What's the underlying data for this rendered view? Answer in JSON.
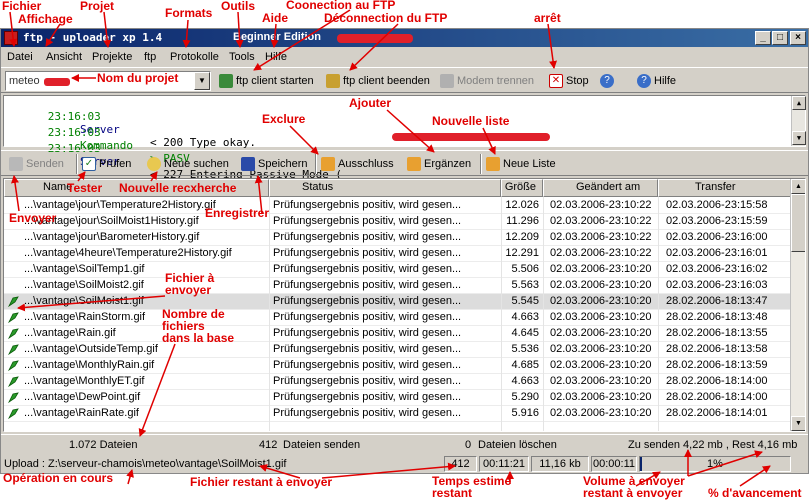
{
  "window": {
    "title": "ftp - uploader  xp 1.4",
    "edition": "Beginner Edition",
    "controls": [
      "_",
      "□",
      "×"
    ]
  },
  "menu": [
    "Datei",
    "Ansicht",
    "Projekte",
    "ftp",
    "Protokolle",
    "Tools",
    "Hilfe"
  ],
  "toolbar1": {
    "project_value": "meteo",
    "buttons": [
      {
        "label": "ftp client starten",
        "icon": "connect-icon"
      },
      {
        "label": "ftp client beenden",
        "icon": "disconnect-icon"
      },
      {
        "label": "Modem trennen",
        "icon": "modem-icon"
      },
      {
        "label": "Stop",
        "icon": "stop-icon"
      },
      {
        "label": "",
        "icon": "help-question-icon"
      },
      {
        "label": "Hilfe",
        "icon": "help-icon"
      }
    ]
  },
  "log": [
    {
      "time": "23:16:03",
      "source": "Server",
      "message": "< 200 Type okay."
    },
    {
      "time": "23:16:03",
      "source": "Kommando",
      "message": "> PASV"
    },
    {
      "time": "23:16:03",
      "source": "Server",
      "message": "< 227 Entering Passive Mode ("
    }
  ],
  "toolbar2": {
    "buttons": [
      {
        "label": "Senden",
        "icon": "send-icon",
        "enabled": false
      },
      {
        "label": "Prüfen",
        "icon": "check-icon",
        "enabled": true
      },
      {
        "label": "Neue suchen",
        "icon": "search-icon",
        "enabled": true
      },
      {
        "label": "Speichern",
        "icon": "save-icon",
        "enabled": true
      },
      {
        "label": "Ausschluss",
        "icon": "exclude-icon",
        "enabled": true
      },
      {
        "label": "Ergänzen",
        "icon": "add-icon",
        "enabled": true
      },
      {
        "label": "Neue Liste",
        "icon": "new-list-icon",
        "enabled": true
      }
    ]
  },
  "table": {
    "columns": [
      "Name",
      "Status",
      "Größe",
      "Geändert am",
      "Transfer"
    ],
    "rows": [
      {
        "name": "...\\vantage\\jour\\Temperature2History.gif",
        "status": "Prüfungsergebnis positiv, wird gesen...",
        "size": "12.026",
        "changed": "02.03.2006-23:10:22",
        "transfer": "02.03.2006-23:15:58",
        "icon": false,
        "selected": false
      },
      {
        "name": "...\\vantage\\jour\\SoilMoist1History.gif",
        "status": "Prüfungsergebnis positiv, wird gesen...",
        "size": "11.296",
        "changed": "02.03.2006-23:10:22",
        "transfer": "02.03.2006-23:15:59",
        "icon": false,
        "selected": false
      },
      {
        "name": "...\\vantage\\jour\\BarometerHistory.gif",
        "status": "Prüfungsergebnis positiv, wird gesen...",
        "size": "12.209",
        "changed": "02.03.2006-23:10:22",
        "transfer": "02.03.2006-23:16:00",
        "icon": false,
        "selected": false
      },
      {
        "name": "...\\vantage\\4heure\\Temperature2History.gif",
        "status": "Prüfungsergebnis positiv, wird gesen...",
        "size": "12.291",
        "changed": "02.03.2006-23:10:22",
        "transfer": "02.03.2006-23:16:01",
        "icon": false,
        "selected": false
      },
      {
        "name": "...\\vantage\\SoilTemp1.gif",
        "status": "Prüfungsergebnis positiv, wird gesen...",
        "size": "5.506",
        "changed": "02.03.2006-23:10:20",
        "transfer": "02.03.2006-23:16:02",
        "icon": false,
        "selected": false
      },
      {
        "name": "...\\vantage\\SoilMoist2.gif",
        "status": "Prüfungsergebnis positiv, wird gesen...",
        "size": "5.563",
        "changed": "02.03.2006-23:10:20",
        "transfer": "02.03.2006-23:16:03",
        "icon": false,
        "selected": false
      },
      {
        "name": "...\\vantage\\SoilMoist1.gif",
        "status": "Prüfungsergebnis positiv, wird gesen...",
        "size": "5.545",
        "changed": "02.03.2006-23:10:20",
        "transfer": "28.02.2006-18:13:47",
        "icon": true,
        "selected": true
      },
      {
        "name": "...\\vantage\\RainStorm.gif",
        "status": "Prüfungsergebnis positiv, wird gesen...",
        "size": "4.663",
        "changed": "02.03.2006-23:10:20",
        "transfer": "28.02.2006-18:13:48",
        "icon": true,
        "selected": false
      },
      {
        "name": "...\\vantage\\Rain.gif",
        "status": "Prüfungsergebnis positiv, wird gesen...",
        "size": "4.645",
        "changed": "02.03.2006-23:10:20",
        "transfer": "28.02.2006-18:13:55",
        "icon": true,
        "selected": false
      },
      {
        "name": "...\\vantage\\OutsideTemp.gif",
        "status": "Prüfungsergebnis positiv, wird gesen...",
        "size": "5.536",
        "changed": "02.03.2006-23:10:20",
        "transfer": "28.02.2006-18:13:58",
        "icon": true,
        "selected": false
      },
      {
        "name": "...\\vantage\\MonthlyRain.gif",
        "status": "Prüfungsergebnis positiv, wird gesen...",
        "size": "4.685",
        "changed": "02.03.2006-23:10:20",
        "transfer": "28.02.2006-18:13:59",
        "icon": true,
        "selected": false
      },
      {
        "name": "...\\vantage\\MonthlyET.gif",
        "status": "Prüfungsergebnis positiv, wird gesen...",
        "size": "4.663",
        "changed": "02.03.2006-23:10:20",
        "transfer": "28.02.2006-18:14:00",
        "icon": true,
        "selected": false
      },
      {
        "name": "...\\vantage\\DewPoint.gif",
        "status": "Prüfungsergebnis positiv, wird gesen...",
        "size": "5.290",
        "changed": "02.03.2006-23:10:20",
        "transfer": "28.02.2006-18:14:00",
        "icon": true,
        "selected": false
      },
      {
        "name": "...\\vantage\\RainRate.gif",
        "status": "Prüfungsergebnis positiv, wird gesen...",
        "size": "5.916",
        "changed": "02.03.2006-23:10:20",
        "transfer": "28.02.2006-18:14:01",
        "icon": true,
        "selected": false
      }
    ]
  },
  "status": {
    "files": "1.072 Dateien",
    "send_count": "412",
    "send_label": "Dateien senden",
    "delete_count": "0",
    "delete_label": "Dateien löschen",
    "volume": "Zu senden 4,22 mb , Rest 4,16 mb",
    "upload_path": "Upload : Z:\\serveur-chamois\\meteo\\vantage\\SoilMoist1.gif",
    "remaining_files": "412",
    "estimated_time": "00:11:21",
    "speed": "11,16  kb",
    "elapsed": "00:00:11",
    "progress_text": "1%",
    "progress": 0.01
  },
  "annotations": {
    "fichier": "Fichier",
    "affichage": "Affichage",
    "projet": "Projet",
    "formats": "Formats",
    "outils": "Outils",
    "aide": "Aide",
    "connexion": "Coonection au FTP",
    "deconnexion": "Déconnection du FTP",
    "arret": "arrêt",
    "nom_projet": "Nom du projet",
    "ajouter": "Ajouter",
    "exclure": "Exclure",
    "nouvelle_liste": "Nouvelle liste",
    "tester": "Tester",
    "nouvelle_recherche": "Nouvelle recxherche",
    "envoyer": "Envoyer",
    "enregistrer": "Enregistrer",
    "fichier_envoyer": "Fichier à\nenvoyer",
    "nombre_fichiers": "Nombre de\nfichiers\ndans la base",
    "operation": "Opération en cours",
    "fichier_restant": "Fichier restant à envoyer",
    "temps_estime": "Temps estimé\nrestant",
    "volume_envoyer": "Volume   à envoyer\nrestant à envoyer",
    "pct_avancement": "% d'avancement"
  },
  "colors": {
    "annotation": "#e00000",
    "titlebar": "#0a246a",
    "window_bg": "#d4d0c8",
    "log_time": "#008000",
    "log_server": "#000080"
  }
}
